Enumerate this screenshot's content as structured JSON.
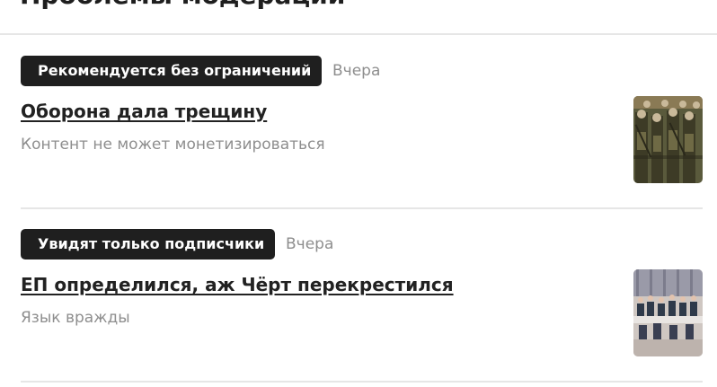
{
  "header": {
    "title": "Проблемы модерации"
  },
  "posts": [
    {
      "badge": "Рекомендуется без ограничений",
      "date": "Вчера",
      "title": "Оборона дала трещину",
      "reason": "Контент не может монетизироваться",
      "thumbnail_icon": "soldiers-parade-image"
    },
    {
      "badge": "Увидят только подписчики",
      "date": "Вчера",
      "title": "ЕП определился, аж Чёрт перекрестился",
      "reason": "Язык вражды",
      "thumbnail_icon": "conference-hall-image"
    }
  ],
  "colors": {
    "badge_bg": "#1f1f1f",
    "badge_text": "#ffffff",
    "muted_text": "#8e8e8e",
    "divider": "#e6e6e6"
  }
}
